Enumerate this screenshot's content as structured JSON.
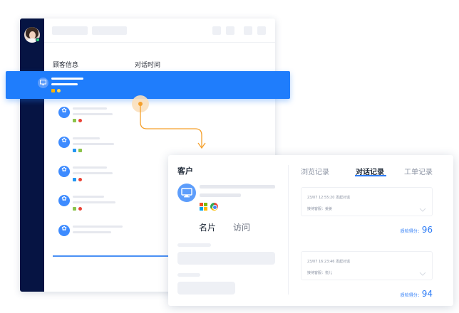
{
  "back_window": {
    "column_headers": [
      "顾客信息",
      "对话时间"
    ]
  },
  "colors": {
    "sidebar_bg": "#061443",
    "highlight": "#1f7dfc",
    "accent": "#2d7cf6",
    "connector": "#f5a02c"
  },
  "customer_card": {
    "title": "客户",
    "sub_tabs": [
      {
        "label": "名片",
        "active": true
      },
      {
        "label": "访问",
        "active": false
      }
    ],
    "platform_icons": [
      "windows-icon",
      "chrome-icon"
    ],
    "record_tabs": [
      {
        "label": "浏览记录",
        "active": false
      },
      {
        "label": "对话记录",
        "active": true
      },
      {
        "label": "工单记录",
        "active": false
      }
    ],
    "records": [
      {
        "time": "23/07  12:55:20  发起对话",
        "agent": "接待客服：姜姜",
        "score_label": "质检得分：",
        "score": "96"
      },
      {
        "time": "23/07  16:23:46  发起对话",
        "agent": "接待客服：悦儿",
        "score_label": "质检得分：",
        "score": "94"
      }
    ]
  }
}
